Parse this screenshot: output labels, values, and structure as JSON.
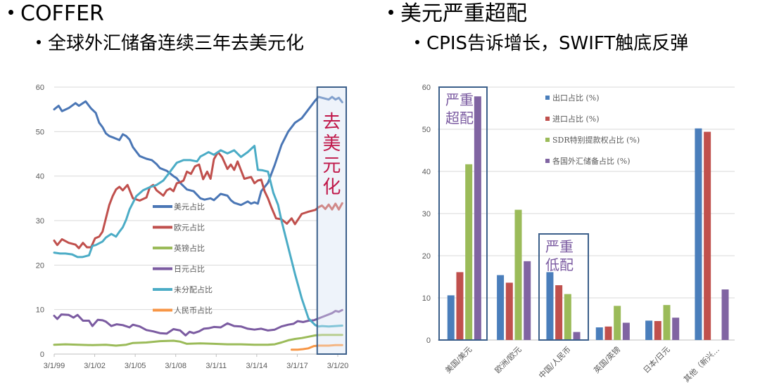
{
  "slide": {
    "left_heading": "COFFER",
    "left_subheading": "全球外汇储备连续三年去美元化",
    "right_heading": "美元严重超配",
    "right_subheading": "CPIS告诉增长，SWIFT触底反弹"
  },
  "chart_data": [
    {
      "type": "line",
      "title": "",
      "xlabel": "",
      "ylabel": "",
      "ylim": [
        0,
        60
      ],
      "yticks": [
        "0",
        "10",
        "20",
        "30",
        "40",
        "50",
        "60"
      ],
      "xticks": [
        "3/1/99",
        "3/1/02",
        "3/1/05",
        "3/1/08",
        "3/1/11",
        "3/1/14",
        "3/1/17",
        "3/1/20"
      ],
      "xlim": [
        1999.17,
        2020.5
      ],
      "grid": true,
      "legend_position": "center-right",
      "annotation": {
        "text": "去美元化",
        "range_start": 2018.75,
        "range_end": 2020.5,
        "color": "#c0184a"
      },
      "series": [
        {
          "name": "美元占比",
          "color": "#4a76b5",
          "x": [
            1999.17,
            1999.5,
            1999.75,
            2000.25,
            2000.75,
            2001.0,
            2001.5,
            2001.9,
            2002.25,
            2002.5,
            2002.75,
            2003.0,
            2003.25,
            2003.6,
            2004.0,
            2004.25,
            2004.5,
            2004.75,
            2005.0,
            2005.5,
            2006.0,
            2006.4,
            2006.75,
            2007.0,
            2007.5,
            2008.0,
            2008.25,
            2008.5,
            2009.0,
            2009.5,
            2010.0,
            2010.3,
            2010.75,
            2011.0,
            2011.5,
            2012.0,
            2012.25,
            2012.5,
            2013.0,
            2013.5,
            2013.75,
            2014.0,
            2014.25,
            2014.5,
            2015.0,
            2015.5,
            2016.0,
            2016.5,
            2017.0,
            2017.5,
            2018.0,
            2018.5,
            2018.75,
            2019.0,
            2019.5,
            2019.75,
            2020.0,
            2020.25,
            2020.5
          ],
          "y": [
            55,
            55.8,
            54.6,
            55.3,
            56.4,
            55.8,
            56.8,
            55.2,
            54.2,
            52,
            51,
            49.6,
            49,
            48.6,
            48.1,
            49.4,
            49,
            48.2,
            46.5,
            44.5,
            43.9,
            43.6,
            42.7,
            41.8,
            41.2,
            40,
            39.5,
            38.5,
            37,
            36.6,
            35,
            34.7,
            35,
            34.6,
            36,
            35.6,
            34.6,
            34,
            33.5,
            34.3,
            33.8,
            34.1,
            33.8,
            36.6,
            38.5,
            42.5,
            47,
            50,
            52,
            53,
            55,
            57,
            57.8,
            57.6,
            57.2,
            57.8,
            57.2,
            57.6,
            56.6
          ]
        },
        {
          "name": "欧元占比",
          "color": "#c0504d",
          "x": [
            1999.17,
            1999.4,
            1999.75,
            2000.25,
            2000.75,
            2001.0,
            2001.3,
            2001.6,
            2001.9,
            2002.2,
            2002.5,
            2002.75,
            2003.0,
            2003.25,
            2003.5,
            2003.75,
            2004.0,
            2004.25,
            2004.6,
            2005.0,
            2005.5,
            2006.0,
            2006.25,
            2006.5,
            2006.75,
            2007.0,
            2007.25,
            2007.5,
            2007.75,
            2008.0,
            2008.25,
            2008.5,
            2008.75,
            2009.0,
            2009.3,
            2009.6,
            2009.9,
            2010.2,
            2010.5,
            2010.75,
            2011.0,
            2011.3,
            2011.6,
            2012.0,
            2012.25,
            2012.5,
            2012.75,
            2013.25,
            2013.75,
            2014.0,
            2014.25,
            2014.5,
            2014.75,
            2015.0,
            2015.25,
            2015.6,
            2016.0,
            2016.4,
            2016.75,
            2017.0,
            2017.5,
            2018.0,
            2018.5,
            2018.75,
            2019.0,
            2019.25,
            2019.5,
            2019.75,
            2020.0,
            2020.25,
            2020.5
          ],
          "y": [
            25.5,
            24.5,
            25.8,
            25,
            24.6,
            23.8,
            25,
            24,
            24,
            26,
            26.4,
            27.5,
            30.5,
            33.5,
            35.5,
            37,
            37.6,
            36.8,
            38,
            35,
            34.5,
            35.2,
            37.5,
            38,
            36.8,
            36.2,
            35.6,
            36.8,
            37.2,
            36.6,
            38.4,
            38.6,
            39,
            41,
            40.5,
            42.2,
            42.6,
            39.3,
            41,
            39.4,
            43.8,
            45.4,
            44.3,
            41.6,
            42.6,
            41.4,
            43.3,
            39.4,
            39.8,
            38.4,
            39,
            39.2,
            36.6,
            35,
            33,
            30.5,
            30.3,
            29.3,
            30.5,
            29.2,
            31.5,
            32,
            32.4,
            33,
            33.4,
            32.6,
            33.6,
            32.5,
            33.8,
            32.5,
            33.9
          ]
        },
        {
          "name": "英镑占比",
          "color": "#9bbb59",
          "x": [
            1999.17,
            2000.0,
            2001.0,
            2002.0,
            2003.0,
            2003.75,
            2004.5,
            2005.0,
            2006.0,
            2007.0,
            2008.0,
            2008.5,
            2009.0,
            2010.0,
            2011.0,
            2012.0,
            2013.0,
            2014.0,
            2015.0,
            2015.5,
            2016.0,
            2016.5,
            2017.0,
            2017.5,
            2018.0,
            2018.5,
            2019.0,
            2020.0,
            2020.5
          ],
          "y": [
            2.1,
            2.2,
            2.1,
            2.0,
            2.1,
            1.9,
            2.1,
            2.5,
            2.6,
            2.9,
            3.0,
            2.8,
            2.3,
            2.4,
            2.3,
            2.2,
            2.2,
            2.1,
            2.1,
            2.2,
            2.6,
            3.1,
            3.4,
            3.6,
            3.9,
            4.2,
            4.3,
            4.3,
            4.3
          ]
        },
        {
          "name": "日元占比",
          "color": "#7b5ba1",
          "x": [
            1999.17,
            1999.4,
            1999.7,
            2000.25,
            2000.6,
            2000.9,
            2001.3,
            2001.75,
            2002.0,
            2002.4,
            2002.75,
            2003.0,
            2003.4,
            2003.8,
            2004.25,
            2004.75,
            2005.0,
            2005.5,
            2006.0,
            2006.5,
            2007.0,
            2007.5,
            2008.0,
            2008.5,
            2008.9,
            2009.2,
            2009.5,
            2009.9,
            2010.25,
            2010.6,
            2011.0,
            2011.5,
            2012.0,
            2012.5,
            2013.0,
            2013.5,
            2014.0,
            2014.5,
            2015.0,
            2015.5,
            2016.0,
            2016.5,
            2016.9,
            2017.2,
            2017.6,
            2018.0,
            2018.4,
            2018.75,
            2019.0,
            2019.5,
            2019.75,
            2020.0,
            2020.25,
            2020.5
          ],
          "y": [
            8.6,
            7.9,
            8.9,
            8.8,
            8.2,
            8.8,
            7.5,
            7.5,
            6.3,
            7.7,
            7.6,
            7.3,
            6.3,
            6.7,
            6.5,
            6.0,
            6.6,
            6.2,
            5.4,
            5.1,
            4.7,
            4.6,
            5.6,
            5.3,
            4.2,
            5.0,
            4.7,
            5.1,
            5.7,
            5.8,
            6.1,
            6.0,
            6.9,
            6.3,
            6.2,
            5.7,
            5.5,
            5.7,
            5.3,
            5.5,
            6.2,
            6.6,
            6.8,
            7.4,
            7.2,
            7.5,
            7.6,
            8.0,
            8.3,
            8.9,
            9.2,
            9.7,
            9.5,
            9.9
          ]
        },
        {
          "name": "未分配占比",
          "color": "#4bacc6",
          "x": [
            1999.17,
            1999.6,
            2000.0,
            2000.5,
            2000.9,
            2001.25,
            2001.75,
            2002.0,
            2002.25,
            2002.75,
            2003.0,
            2003.4,
            2003.75,
            2004.0,
            2004.25,
            2004.5,
            2004.75,
            2005.0,
            2005.25,
            2005.75,
            2006.25,
            2006.75,
            2007.25,
            2007.75,
            2008.25,
            2008.75,
            2009.25,
            2009.75,
            2010.0,
            2010.25,
            2010.6,
            2011.0,
            2011.5,
            2012.0,
            2012.5,
            2013.0,
            2013.5,
            2014.0,
            2014.25,
            2014.6,
            2015.0,
            2015.4,
            2015.75,
            2016.0,
            2016.5,
            2017.0,
            2017.5,
            2018.0,
            2018.5,
            2018.75,
            2019.0,
            2019.5,
            2020.0,
            2020.5
          ],
          "y": [
            22.8,
            22.6,
            22.6,
            22.4,
            21.8,
            21.8,
            22.2,
            24.3,
            24.5,
            25.3,
            26.2,
            27.0,
            26.4,
            27.5,
            28.5,
            30.2,
            32.5,
            34.0,
            35.5,
            36.8,
            37.5,
            38.0,
            39.0,
            41.0,
            43.0,
            43.6,
            43.6,
            43.3,
            44.4,
            44.8,
            45.4,
            44.8,
            45.8,
            45.1,
            45.8,
            44.3,
            45.4,
            46.8,
            41.4,
            41.3,
            41.0,
            36.2,
            33.5,
            30.0,
            24.0,
            18.0,
            12.5,
            8.0,
            6.5,
            6.2,
            6.3,
            6.2,
            6.3,
            6.4
          ]
        },
        {
          "name": "人民币占比",
          "color": "#f79646",
          "x": [
            2016.75,
            2017.2,
            2017.6,
            2018.0,
            2018.4,
            2018.75,
            2019.0,
            2019.5,
            2020.0,
            2020.5
          ],
          "y": [
            1.0,
            1.0,
            1.1,
            1.3,
            1.8,
            1.9,
            1.9,
            1.9,
            2.0,
            2.0
          ]
        }
      ]
    },
    {
      "type": "bar",
      "title": "",
      "xlabel": "",
      "ylabel": "",
      "ylim": [
        0,
        60
      ],
      "yticks": [
        "0",
        "10",
        "20",
        "30",
        "40",
        "50",
        "60"
      ],
      "grid": true,
      "legend_position": "top-center",
      "categories": [
        "美国/美元",
        "欧洲/欧元",
        "中国/人民币",
        "英国/英镑",
        "日本/日元",
        "其他（新兴…"
      ],
      "series": [
        {
          "name": "出口占比 (%)",
          "color": "#4a7ebb",
          "values": [
            10.6,
            15.4,
            16.1,
            3.0,
            4.6,
            50.2
          ]
        },
        {
          "name": "进口占比 (%)",
          "color": "#c0504d",
          "values": [
            16.1,
            13.6,
            13.0,
            3.2,
            4.5,
            49.4
          ]
        },
        {
          "name": "SDR特别提款权占比 (%)",
          "color": "#9bbb59",
          "values": [
            41.7,
            30.9,
            10.9,
            8.1,
            8.3,
            null
          ]
        },
        {
          "name": "各国外汇储备占比 (%)",
          "color": "#8064a2",
          "values": [
            57.8,
            18.7,
            1.9,
            4.1,
            5.3,
            12.0
          ]
        }
      ],
      "annotations": [
        {
          "text_line1": "严重",
          "text_line2": "超配",
          "category": "美国/美元",
          "color": "#7b5ba1"
        },
        {
          "text_line1": "严重",
          "text_line2": "低配",
          "category": "中国/人民币",
          "color": "#7b5ba1"
        }
      ]
    }
  ]
}
